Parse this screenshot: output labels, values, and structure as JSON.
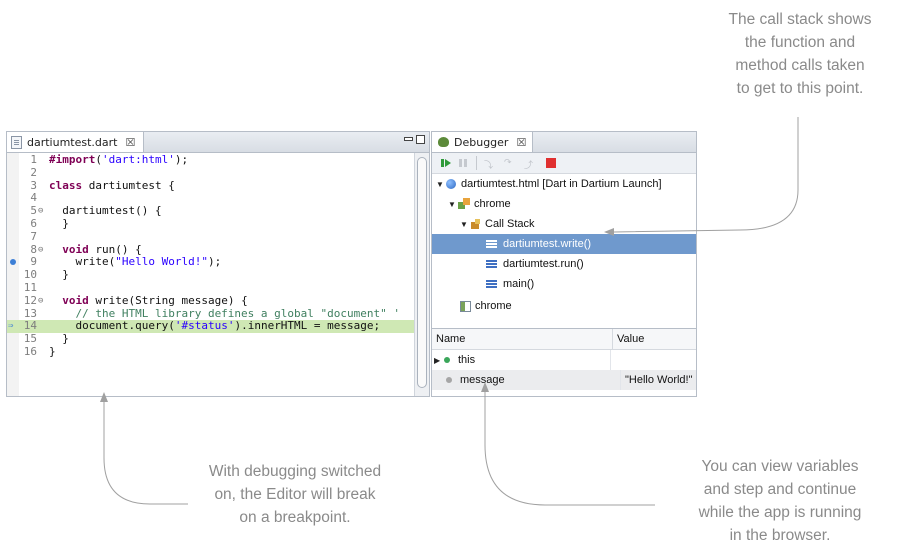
{
  "annotations": {
    "call_stack": [
      "The call stack shows",
      "the function and",
      "method calls taken",
      "to get to this point."
    ],
    "breakpoint": [
      "With debugging switched",
      "on, the Editor will break",
      "on a breakpoint."
    ],
    "variables": [
      "You can view variables",
      "and step and continue",
      "while the app is running",
      "in the browser."
    ]
  },
  "editor": {
    "tab_label": "dartiumtest.dart",
    "close_glyph": "☒",
    "lines": [
      {
        "n": "1",
        "fold": "",
        "parts": [
          [
            "kw",
            "#import"
          ],
          [
            "",
            "("
          ],
          [
            "str",
            "'dart:html'"
          ],
          [
            "",
            ");"
          ]
        ]
      },
      {
        "n": "2",
        "fold": "",
        "parts": []
      },
      {
        "n": "3",
        "fold": "",
        "parts": [
          [
            "kw",
            "class"
          ],
          [
            "",
            " dartiumtest {"
          ]
        ]
      },
      {
        "n": "4",
        "fold": "",
        "parts": []
      },
      {
        "n": "5",
        "fold": "⊖",
        "parts": [
          [
            "",
            "  dartiumtest() {"
          ]
        ]
      },
      {
        "n": "6",
        "fold": "",
        "parts": [
          [
            "",
            "  }"
          ]
        ]
      },
      {
        "n": "7",
        "fold": "",
        "parts": []
      },
      {
        "n": "8",
        "fold": "⊖",
        "parts": [
          [
            "",
            "  "
          ],
          [
            "kw",
            "void"
          ],
          [
            "",
            " run() {"
          ]
        ]
      },
      {
        "n": "9",
        "fold": "",
        "parts": [
          [
            "",
            "    write("
          ],
          [
            "str",
            "\"Hello World!\""
          ],
          [
            "",
            ");"
          ]
        ]
      },
      {
        "n": "10",
        "fold": "",
        "parts": [
          [
            "",
            "  }"
          ]
        ]
      },
      {
        "n": "11",
        "fold": "",
        "parts": []
      },
      {
        "n": "12",
        "fold": "⊖",
        "parts": [
          [
            "",
            "  "
          ],
          [
            "kw",
            "void"
          ],
          [
            "",
            " write(String message) {"
          ]
        ]
      },
      {
        "n": "13",
        "fold": "",
        "parts": [
          [
            "cmt",
            "    // the HTML library defines a global \"document\" '"
          ]
        ]
      },
      {
        "n": "14",
        "fold": "",
        "parts": [
          [
            "",
            "    document.query("
          ],
          [
            "str",
            "'#status'"
          ],
          [
            "",
            ").innerHTML = message;"
          ]
        ]
      },
      {
        "n": "15",
        "fold": "",
        "parts": [
          [
            "",
            "  }"
          ]
        ]
      },
      {
        "n": "16",
        "fold": "",
        "parts": [
          [
            "",
            "}"
          ]
        ]
      }
    ],
    "highlight_line": "14",
    "breakpoint_line": "9"
  },
  "debugger": {
    "tab_label": "Debugger",
    "close_glyph": "☒",
    "tree": {
      "launch": "dartiumtest.html [Dart in Dartium Launch]",
      "process": "chrome",
      "call_stack": "Call Stack",
      "frames": [
        "dartiumtest.write()",
        "dartiumtest.run()",
        "main()"
      ],
      "thread": "chrome"
    },
    "vars": {
      "col_name": "Name",
      "col_value": "Value",
      "rows": [
        {
          "name": "this",
          "value": "",
          "expand": "▶",
          "color": "#3aa65a"
        },
        {
          "name": "message",
          "value": "\"Hello World!\"",
          "expand": "",
          "color": "#a6a6a6"
        }
      ]
    }
  },
  "colors": {
    "selection": "#6f99cd",
    "highlight": "#cfe8b4",
    "annotation": "#8a8a8a"
  }
}
